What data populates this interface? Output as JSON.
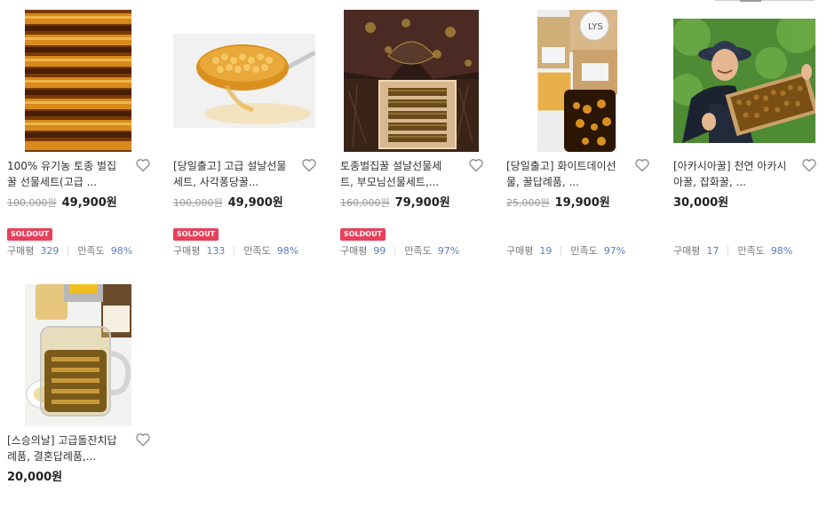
{
  "products": [
    {
      "title": "100% 유기농 토종 벌집꿀 선물세트(고급 ...",
      "original_price": "100,000원",
      "sale_price": "49,900원",
      "badge": "SOLDOUT",
      "review_label": "구매평",
      "review_count": "329",
      "satisfaction_label": "만족도",
      "satisfaction": "98%",
      "image": "honeycomb-close-up"
    },
    {
      "title": "[당일출고] 고급 설날선물세트, 사각퐁당꿀...",
      "original_price": "100,000원",
      "sale_price": "49,900원",
      "badge": "SOLDOUT",
      "review_label": "구매평",
      "review_count": "133",
      "satisfaction_label": "만족도",
      "satisfaction": "98%",
      "image": "honeycomb-on-spoon"
    },
    {
      "title": "토종벌집꿀 설날선물세트, 부모님선물세트,...",
      "original_price": "160,000원",
      "sale_price": "79,900원",
      "badge": "SOLDOUT",
      "review_label": "구매평",
      "review_count": "99",
      "satisfaction_label": "만족도",
      "satisfaction": "97%",
      "image": "gift-box-with-bojagi"
    },
    {
      "title": "[당일출고] 화이트데이선물, 꿀답례품, ...",
      "original_price": "25,000원",
      "sale_price": "19,900원",
      "badge": "",
      "review_label": "구매평",
      "review_count": "19",
      "satisfaction_label": "만족도",
      "satisfaction": "97%",
      "image": "gift-boxes-and-honeycomb-jar"
    },
    {
      "title": "[아카시아꿀] 천연 아카시아꿀, 잡화꿀, ...",
      "original_price": "",
      "sale_price": "30,000원",
      "badge": "",
      "review_label": "구매평",
      "review_count": "17",
      "satisfaction_label": "만족도",
      "satisfaction": "98%",
      "image": "beekeeper-with-frame"
    },
    {
      "title": "[스승의날] 고급돌잔치답례품, 결혼답례품,...",
      "original_price": "",
      "sale_price": "20,000원",
      "badge": "",
      "image": "honey-jars"
    }
  ],
  "colors": {
    "soldout_badge": "#e8405a",
    "stat_number": "#5a7ec8",
    "price": "#222222",
    "original_price": "#999999"
  },
  "icons": {
    "wishlist": "heart-outline-icon"
  }
}
